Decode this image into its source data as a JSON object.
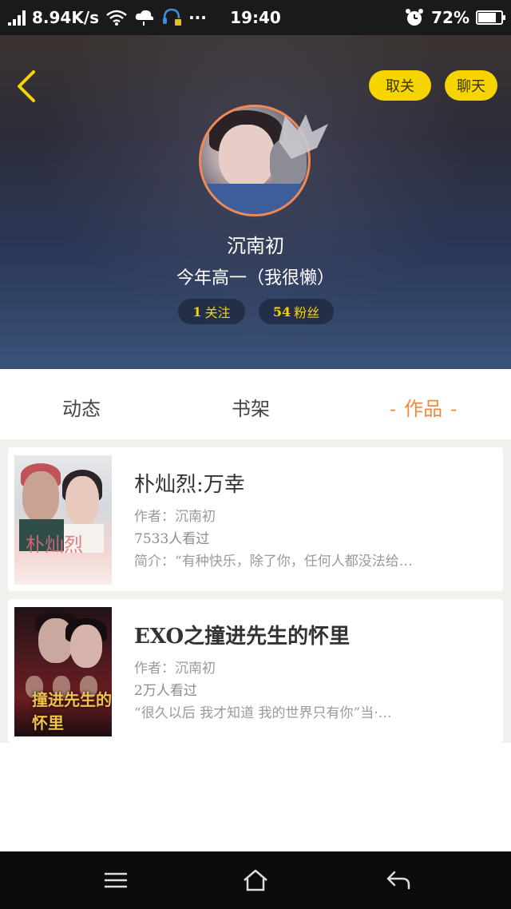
{
  "status_bar": {
    "speed": "8.94K/s",
    "dots": "···",
    "time": "19:40",
    "battery": "72%",
    "battery_level": 0.72
  },
  "header": {
    "unfollow_label": "取关",
    "chat_label": "聊天",
    "username": "沉南初",
    "bio": "今年高一（我很懒）",
    "following_count": "1",
    "following_label": "关注",
    "fans_count": "54",
    "fans_label": "粉丝"
  },
  "tabs": [
    {
      "label": "动态"
    },
    {
      "label": "书架"
    },
    {
      "label": "作品",
      "active": true,
      "dash": "-"
    }
  ],
  "works": [
    {
      "title": "朴灿烈:万幸",
      "author": "作者：沉南初",
      "views": "7533人看过",
      "intro": "简介：“有种快乐，除了你，任何人都没法给…",
      "cover_text": "朴灿烈"
    },
    {
      "title": "EXO之撞进先生的怀里",
      "author": "作者：沉南初",
      "views": "2万人看过",
      "intro": "“很久以后 我才知道 我的世界只有你”当·…",
      "cover_text": "撞进先生的怀里"
    }
  ],
  "colors": {
    "accent_yellow": "#f5d400",
    "active_tab": "#f08a40",
    "avatar_ring": "#f08a55"
  },
  "icons": {
    "back": "chevron-left-icon",
    "crown": "crown-icon",
    "nav_menu": "menu-icon",
    "nav_home": "home-icon",
    "nav_back": "back-arrow-icon"
  }
}
